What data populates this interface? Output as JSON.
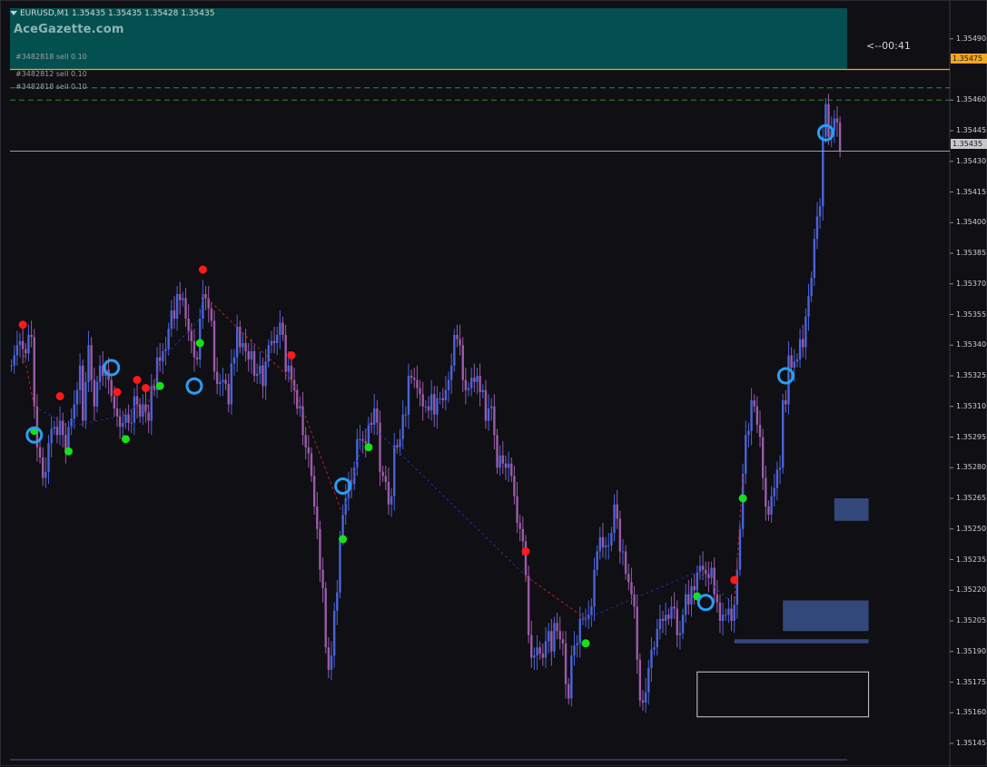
{
  "header": {
    "symbol_line": "EURUSD,M1  1.35435 1.35435 1.35428 1.35435",
    "watermark": "AceGazette.com"
  },
  "orders": [
    {
      "label": "#3482818 sell 0.10",
      "price": 1.35475
    },
    {
      "label": "#3482812 sell 0.10",
      "price": 1.35466
    },
    {
      "label": "#3482818 sell 0.10",
      "price": 1.3546
    }
  ],
  "countdown": "<--00:41",
  "price_axis": {
    "ticks": [
      "1.35490",
      "1.35460",
      "1.35445",
      "1.35430",
      "1.35415",
      "1.35400",
      "1.35385",
      "1.35370",
      "1.35355",
      "1.35340",
      "1.35325",
      "1.35310",
      "1.35295",
      "1.35280",
      "1.35265",
      "1.35250",
      "1.35235",
      "1.35220",
      "1.35205",
      "1.35190",
      "1.35175",
      "1.35160",
      "1.35145"
    ],
    "ask_label": "1.35475",
    "bid_label": "1.35435"
  },
  "colors": {
    "bull": "#4a63d8",
    "bear": "#9b5aa8",
    "top_signal": "#ff1a1a",
    "bottom_signal": "#18e018",
    "ring": "#2a9df4",
    "ask_line": "#f5a623",
    "trade_line": "#2e8b2e",
    "zone_fill": "#33487a",
    "header_zone": "#045050"
  },
  "chart_data": {
    "type": "candlestick",
    "symbol": "EURUSD",
    "timeframe": "M1",
    "ylim": [
      1.35137,
      1.35505
    ],
    "close": [
      1.3533,
      1.35335,
      1.3534,
      1.35342,
      1.35338,
      1.35336,
      1.35345,
      1.35344,
      1.3531,
      1.3529,
      1.35285,
      1.35275,
      1.35278,
      1.35292,
      1.35299,
      1.353,
      1.35296,
      1.35303,
      1.35296,
      1.35289,
      1.353,
      1.35304,
      1.35311,
      1.35318,
      1.3533,
      1.35303,
      1.35322,
      1.3534,
      1.35323,
      1.3531,
      1.35322,
      1.3533,
      1.35325,
      1.35328,
      1.35323,
      1.35315,
      1.35309,
      1.35305,
      1.353,
      1.35302,
      1.35306,
      1.35302,
      1.35302,
      1.35315,
      1.35311,
      1.35305,
      1.35311,
      1.35307,
      1.35303,
      1.3532,
      1.35318,
      1.35334,
      1.35332,
      1.35337,
      1.35338,
      1.35348,
      1.35357,
      1.35353,
      1.35365,
      1.35362,
      1.35363,
      1.35353,
      1.35347,
      1.35342,
      1.35334,
      1.35333,
      1.35353,
      1.35365,
      1.35363,
      1.35358,
      1.35352,
      1.35327,
      1.35321,
      1.35322,
      1.35323,
      1.35321,
      1.35311,
      1.35331,
      1.35334,
      1.35349,
      1.35339,
      1.35341,
      1.35337,
      1.35333,
      1.35337,
      1.35325,
      1.35326,
      1.3533,
      1.3532,
      1.35332,
      1.3534,
      1.35342,
      1.35341,
      1.35345,
      1.35351,
      1.35345,
      1.35327,
      1.3533,
      1.35323,
      1.35318,
      1.35309,
      1.3531,
      1.35296,
      1.3529,
      1.35287,
      1.35276,
      1.35261,
      1.3525,
      1.3523,
      1.35221,
      1.35192,
      1.35181,
      1.35188,
      1.3521,
      1.35219,
      1.35246,
      1.35257,
      1.35265,
      1.35274,
      1.35272,
      1.3528,
      1.35294,
      1.35294,
      1.35293,
      1.35292,
      1.35302,
      1.35301,
      1.35309,
      1.35302,
      1.35278,
      1.35276,
      1.35273,
      1.35262,
      1.35266,
      1.35291,
      1.3529,
      1.35294,
      1.35306,
      1.35306,
      1.35325,
      1.35324,
      1.35323,
      1.35319,
      1.35316,
      1.3531,
      1.3531,
      1.35308,
      1.35316,
      1.35306,
      1.35314,
      1.35314,
      1.35313,
      1.35318,
      1.35323,
      1.3533,
      1.35345,
      1.35343,
      1.3534,
      1.35323,
      1.35318,
      1.35319,
      1.35324,
      1.35322,
      1.35325,
      1.35317,
      1.35318,
      1.35303,
      1.35309,
      1.3531,
      1.35296,
      1.3528,
      1.35286,
      1.35282,
      1.3528,
      1.35282,
      1.35276,
      1.35266,
      1.35253,
      1.3525,
      1.35244,
      1.35227,
      1.35198,
      1.35187,
      1.35188,
      1.35192,
      1.35189,
      1.35187,
      1.35195,
      1.352,
      1.3519,
      1.35204,
      1.352,
      1.35196,
      1.35194,
      1.35174,
      1.35167,
      1.35188,
      1.35193,
      1.35194,
      1.35206,
      1.35206,
      1.35206,
      1.35208,
      1.35212,
      1.3523,
      1.35239,
      1.35246,
      1.35241,
      1.35242,
      1.35242,
      1.35248,
      1.35262,
      1.35255,
      1.35239,
      1.35239,
      1.35228,
      1.35224,
      1.35218,
      1.35212,
      1.35186,
      1.35166,
      1.35165,
      1.3517,
      1.35182,
      1.35191,
      1.35192,
      1.35201,
      1.35206,
      1.35205,
      1.35208,
      1.35206,
      1.35212,
      1.35211,
      1.35198,
      1.35199,
      1.35208,
      1.35218,
      1.35213,
      1.35222,
      1.3522,
      1.35229,
      1.35232,
      1.3523,
      1.35228,
      1.35226,
      1.35231,
      1.35218,
      1.35214,
      1.35205,
      1.35208,
      1.35208,
      1.35211,
      1.35205,
      1.35213,
      1.3523,
      1.3525,
      1.35277,
      1.35296,
      1.35298,
      1.35313,
      1.3531,
      1.35301,
      1.35295,
      1.35275,
      1.35261,
      1.35257,
      1.35266,
      1.3527,
      1.35279,
      1.3528,
      1.35313,
      1.35311,
      1.35335,
      1.35329,
      1.35332,
      1.35333,
      1.35343,
      1.35339,
      1.35354,
      1.35364,
      1.35373,
      1.35392,
      1.35403,
      1.35408,
      1.35442,
      1.35458,
      1.35442,
      1.35445,
      1.35451,
      1.35449,
      1.35435
    ],
    "last_price": 1.35435,
    "ask": 1.35475,
    "top_signal_indices": [
      4,
      17,
      37,
      44,
      47,
      67,
      98,
      180,
      253
    ],
    "bottom_signal_indices": [
      8,
      20,
      40,
      52,
      66,
      116,
      125,
      201,
      240,
      256
    ],
    "ring_indices": [
      8,
      35,
      64,
      116,
      243,
      271,
      285
    ],
    "zones": [
      {
        "start_index": 288,
        "end_index": 300,
        "top": 1.35265,
        "bottom": 1.35254
      },
      {
        "start_index": 270,
        "end_index": 300,
        "top": 1.35215,
        "bottom": 1.352
      },
      {
        "start_index": 253,
        "end_index": 300,
        "top": 1.35196,
        "bottom": 1.35194
      }
    ],
    "outline_box": {
      "start_index": 240,
      "end_index": 300,
      "top": 1.3518,
      "bottom": 1.35158
    }
  }
}
